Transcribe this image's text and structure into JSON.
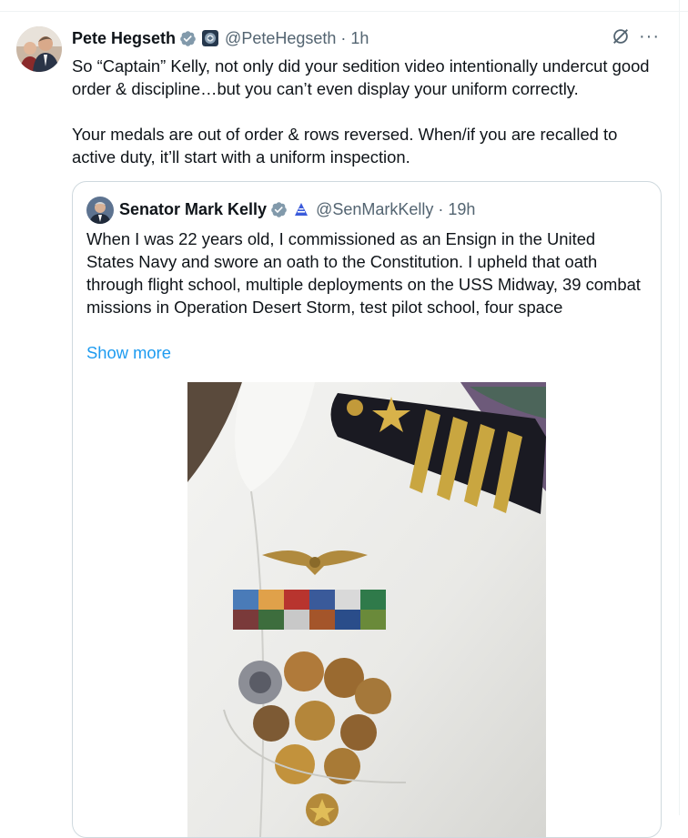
{
  "tweet": {
    "author_name": "Pete Hegseth",
    "handle": "@PeteHegseth",
    "separator": "·",
    "time": "1h",
    "paragraphs": [
      "So “Captain” Kelly, not only did your sedition video intentionally undercut good order & discipline…but you can’t even display your uniform correctly.",
      "Your medals are out of order & rows reversed. When/if you are recalled to active duty, it’ll start with a uniform inspection."
    ],
    "more_label": "···",
    "icons": {
      "verified": "verified-badge-icon",
      "affiliation": "government-seal-icon",
      "grok": "grok-icon",
      "more": "more-icon"
    }
  },
  "quoted": {
    "author_name": "Senator Mark Kelly",
    "handle": "@SenMarkKelly",
    "separator": "·",
    "time": "19h",
    "text": "When I was 22 years old, I commissioned as an Ensign in the United States Navy and swore an oath to the Constitution. I upheld that oath through flight school, multiple deployments on the USS Midway, 39 combat missions in Operation Desert Storm, test pilot school, four space",
    "show_more": "Show more",
    "icons": {
      "verified": "verified-badge-icon",
      "affiliation": "senate-affiliation-icon"
    }
  },
  "colors": {
    "text": "#0f1419",
    "secondary": "#536471",
    "link": "#1d9bf0",
    "verified": "#829aab",
    "border": "#cfd9de"
  }
}
